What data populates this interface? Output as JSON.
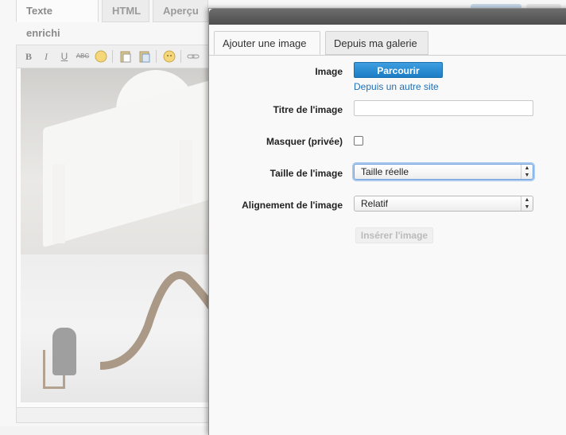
{
  "editor": {
    "tabs": [
      "Texte enrichi",
      "HTML",
      "Aperçu"
    ],
    "toolbar_icons": [
      "bold-icon",
      "italic-icon",
      "underline-icon",
      "strikethrough-icon",
      "smiley-icon",
      "paste-icon",
      "paste-word-icon",
      "emoticon-icon",
      "link-icon"
    ],
    "toolbar_glyphs": {
      "bold": "B",
      "italic": "I",
      "underline": "U",
      "strike": "ABC"
    }
  },
  "modal": {
    "tabs": [
      "Ajouter une image",
      "Depuis ma galerie"
    ],
    "image_label": "Image",
    "browse_button": "Parcourir",
    "other_site_link": "Depuis un autre site",
    "title_label": "Titre de l'image",
    "title_value": "",
    "hide_label": "Masquer (privée)",
    "hide_checked": false,
    "size_label": "Taille de l'image",
    "size_value": "Taille réelle",
    "align_label": "Alignement de l'image",
    "align_value": "Relatif",
    "insert_button": "Insérer l'image"
  },
  "colors": {
    "primary_button": "#1c7dc6",
    "link": "#2170b5",
    "focus_ring": "#a9c9ef"
  }
}
